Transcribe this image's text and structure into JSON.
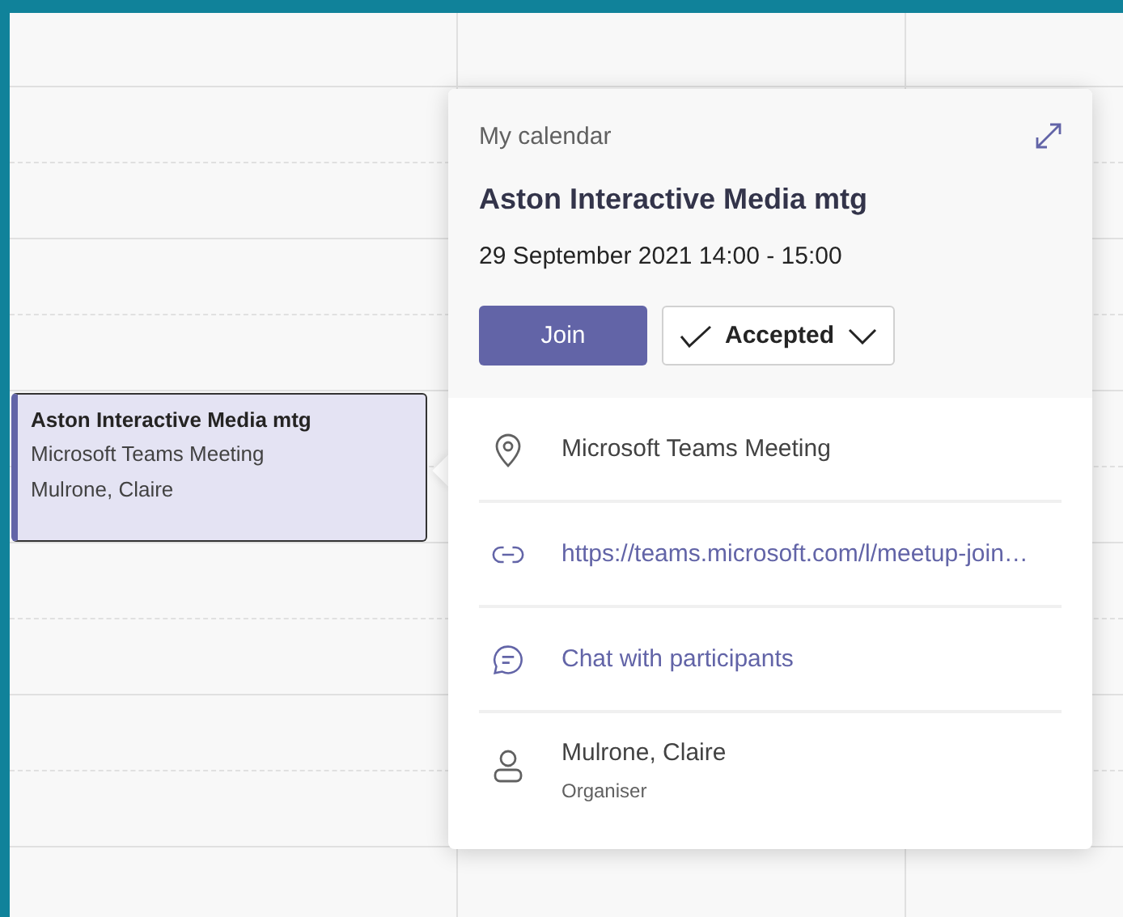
{
  "calendar_event": {
    "title": "Aston Interactive Media mtg",
    "location": "Microsoft Teams Meeting",
    "organiser": "Mulrone, Claire",
    "selected": true
  },
  "popup": {
    "calendar_name": "My calendar",
    "title": "Aston Interactive Media mtg",
    "datetime": "29 September 2021 14:00 - 15:00",
    "join_button": "Join",
    "response": {
      "label": "Accepted",
      "checked": true
    },
    "details": [
      {
        "kind": "location",
        "text": "Microsoft Teams Meeting"
      },
      {
        "kind": "link",
        "text": "https://teams.microsoft.com/l/meetup-join…"
      },
      {
        "kind": "chat",
        "text": "Chat with participants"
      },
      {
        "kind": "person",
        "text": "Mulrone, Claire",
        "role": "Organiser"
      }
    ]
  }
}
